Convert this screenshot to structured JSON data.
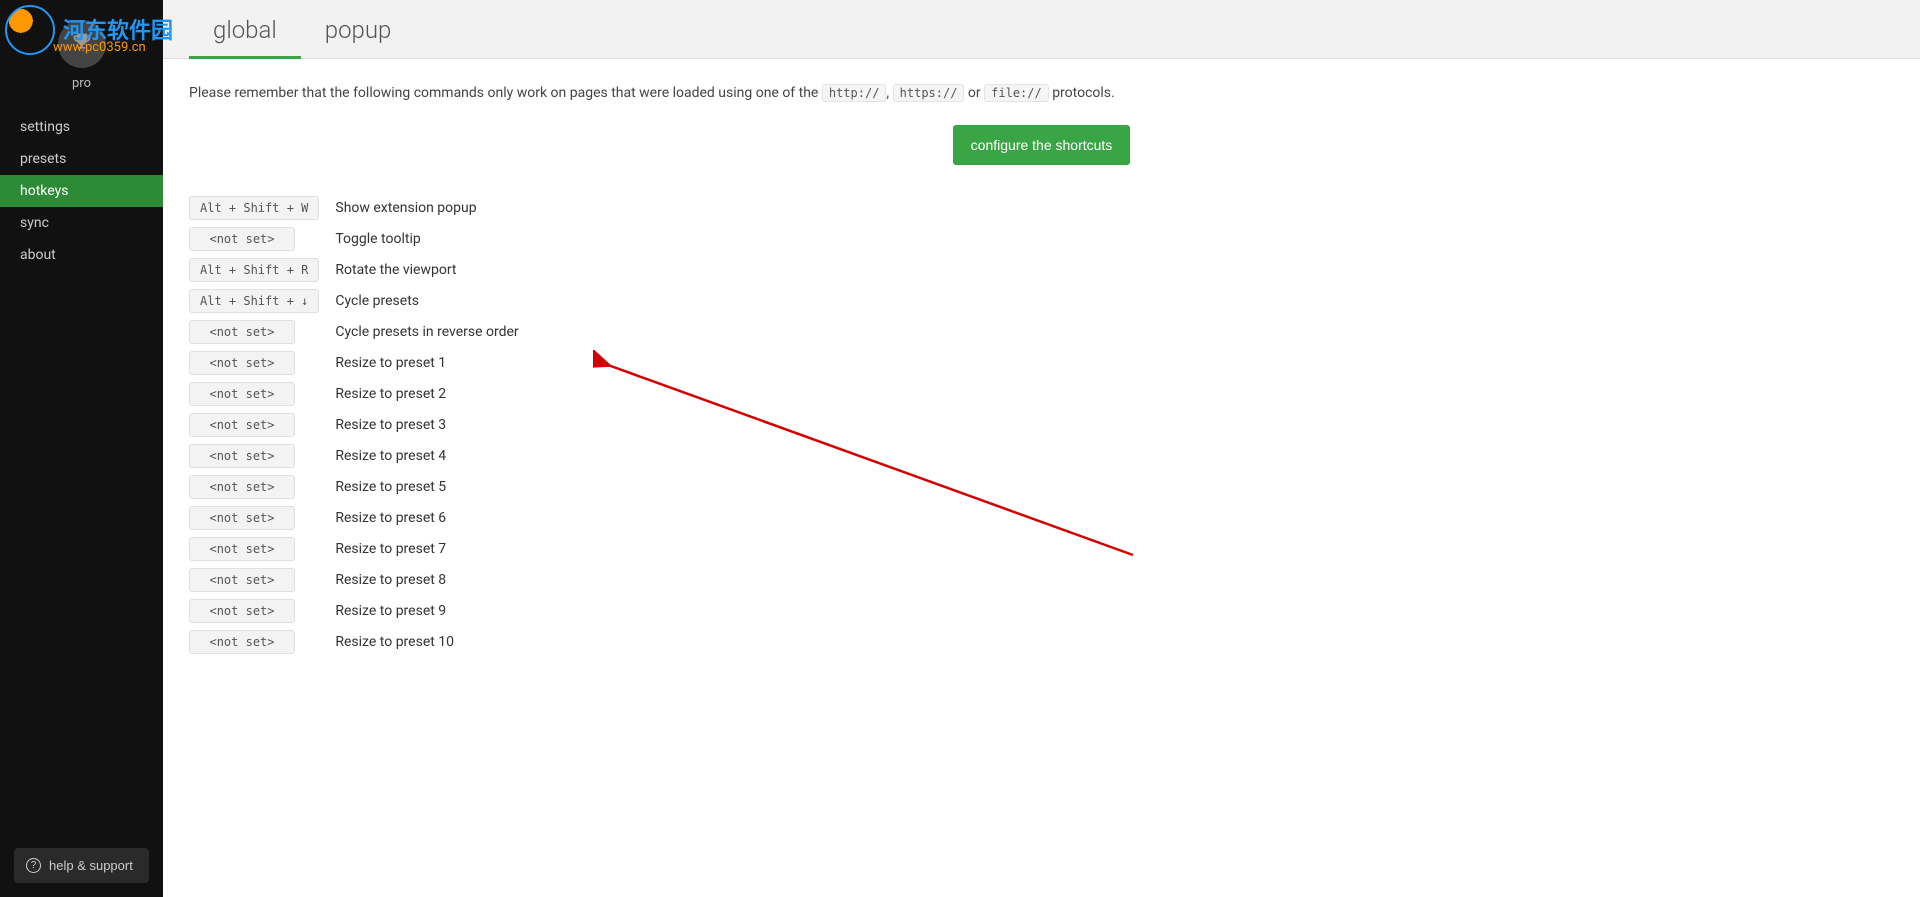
{
  "watermark": {
    "cn": "河东软件园",
    "url": "www.pc0359.cn"
  },
  "sidebar": {
    "user_label": "pro",
    "items": [
      {
        "label": "settings",
        "active": false
      },
      {
        "label": "presets",
        "active": false
      },
      {
        "label": "hotkeys",
        "active": true
      },
      {
        "label": "sync",
        "active": false
      },
      {
        "label": "about",
        "active": false
      }
    ],
    "help_label": "help & support"
  },
  "tabs": [
    {
      "label": "global",
      "active": true
    },
    {
      "label": "popup",
      "active": false
    }
  ],
  "notice": {
    "prefix": "Please remember that the following commands only work on pages that were loaded using one of the ",
    "protocols": [
      "http://",
      "https://",
      "file://"
    ],
    "sep": ", ",
    "or": " or ",
    "suffix": " protocols."
  },
  "configure_label": "configure the shortcuts",
  "hotkeys": [
    {
      "key": "Alt + Shift + W",
      "desc": "Show extension popup"
    },
    {
      "key": "<not set>",
      "desc": "Toggle tooltip"
    },
    {
      "key": "Alt + Shift + R",
      "desc": "Rotate the viewport"
    },
    {
      "key": "Alt + Shift + ↓",
      "desc": "Cycle presets"
    },
    {
      "key": "<not set>",
      "desc": "Cycle presets in reverse order"
    },
    {
      "key": "<not set>",
      "desc": "Resize to preset 1"
    },
    {
      "key": "<not set>",
      "desc": "Resize to preset 2"
    },
    {
      "key": "<not set>",
      "desc": "Resize to preset 3"
    },
    {
      "key": "<not set>",
      "desc": "Resize to preset 4"
    },
    {
      "key": "<not set>",
      "desc": "Resize to preset 5"
    },
    {
      "key": "<not set>",
      "desc": "Resize to preset 6"
    },
    {
      "key": "<not set>",
      "desc": "Resize to preset 7"
    },
    {
      "key": "<not set>",
      "desc": "Resize to preset 8"
    },
    {
      "key": "<not set>",
      "desc": "Resize to preset 9"
    },
    {
      "key": "<not set>",
      "desc": "Resize to preset 10"
    }
  ]
}
